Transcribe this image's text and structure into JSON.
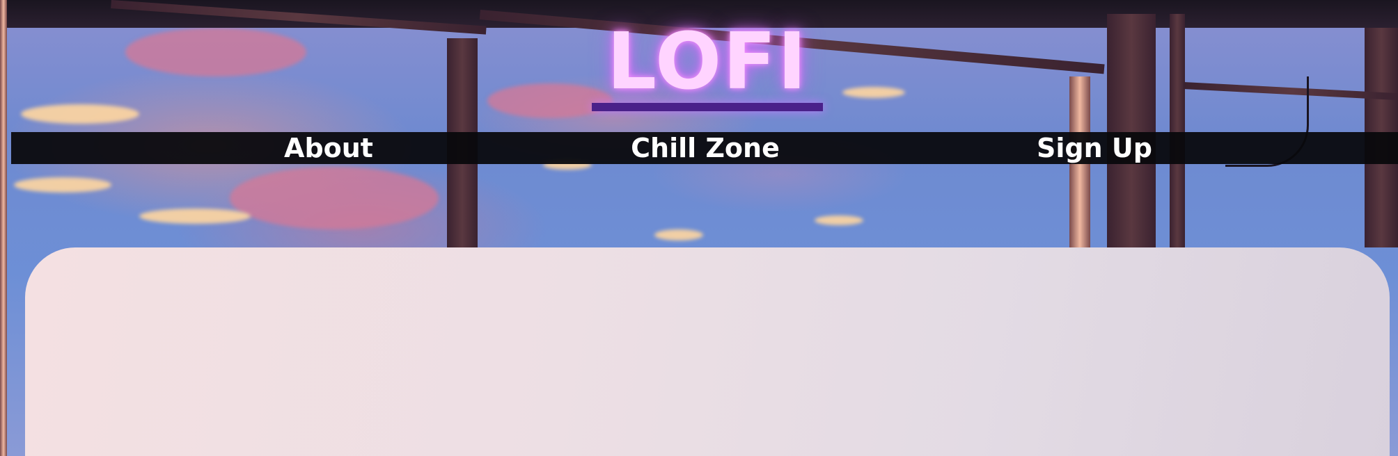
{
  "header": {
    "logo_text": "LOFI"
  },
  "nav": {
    "items": [
      {
        "label": "About"
      },
      {
        "label": "Chill Zone"
      },
      {
        "label": "Sign Up"
      }
    ]
  },
  "colors": {
    "logo_fill": "#ffd4ff",
    "logo_glow": "#e06cff",
    "logo_underline": "#4a218a",
    "nav_bar": "#08090c",
    "nav_text": "#ffffff",
    "card_start": "#f4e0e2",
    "card_end": "#d9d1dd"
  },
  "background": {
    "description_icon": "sunset-window-scene"
  }
}
